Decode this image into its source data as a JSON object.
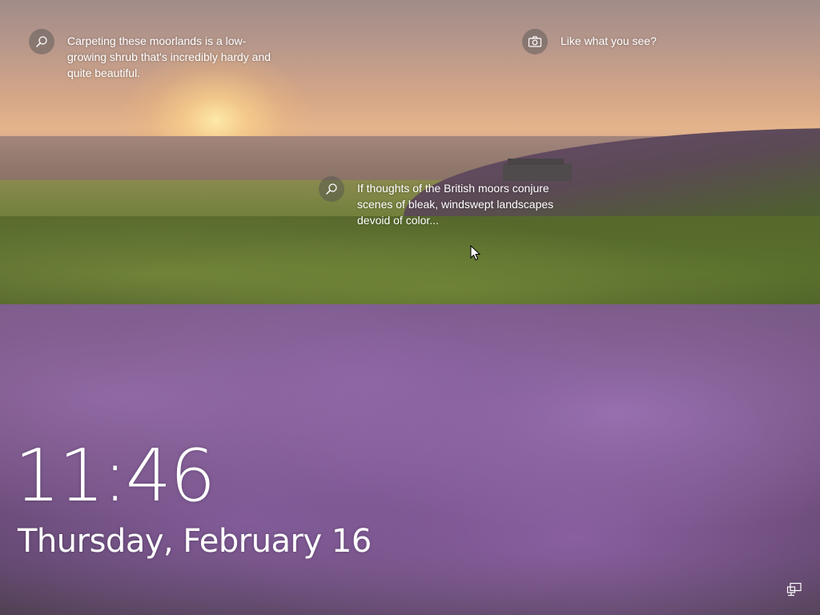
{
  "lock_screen": {
    "time": "11:46",
    "date": "Thursday, February 16",
    "spotlight": {
      "hint_heather": {
        "icon": "magnifier-icon",
        "text_line1": "Carpeting these moorlands is a low-",
        "text_line2": "growing shrub that's incredibly hardy and",
        "text_line3": "quite beautiful."
      },
      "like_prompt": {
        "icon": "camera-icon",
        "text": "Like what you see?"
      },
      "hint_moors": {
        "icon": "magnifier-icon",
        "text_line1": "If thoughts of the British moors conjure",
        "text_line2": "scenes of bleak, windswept landscapes",
        "text_line3": "devoid of color..."
      }
    },
    "status_icons": [
      "network-icon"
    ],
    "colors": {
      "text": "#ffffff",
      "icon_circle": "#505050"
    }
  }
}
